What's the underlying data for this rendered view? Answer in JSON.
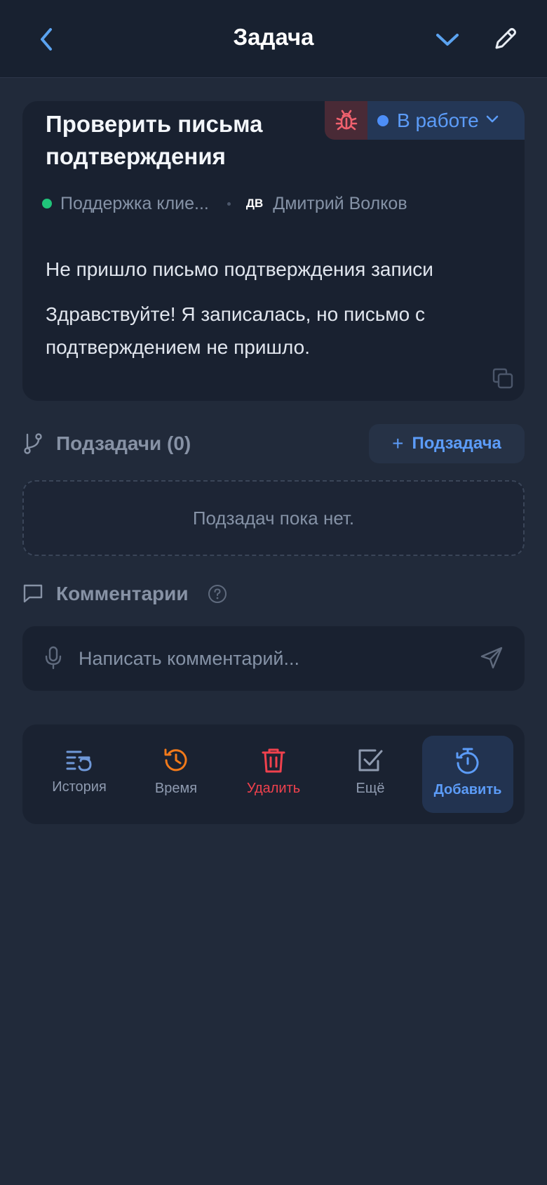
{
  "header": {
    "title": "Задача",
    "back_icon": "chevron-left-icon",
    "collapse_icon": "chevron-down-icon",
    "edit_icon": "pencil-icon"
  },
  "task": {
    "title": "Проверить письма подтверждения",
    "type_icon": "bug-icon",
    "status": "В работе",
    "status_color": "#4d8ef7",
    "project": "Поддержка клие...",
    "project_color": "#20c47a",
    "assignee_initials": "ДВ",
    "assignee": "Дмитрий Волков",
    "description_title": "Не пришло письмо подтверждения записи",
    "description_body": "Здравствуйте! Я записалась, но письмо с подтверждением не пришло."
  },
  "subtasks": {
    "label": "Подзадачи (0)",
    "add_plus": "+",
    "add_label": "Подзадача",
    "empty_text": "Подзадач пока нет."
  },
  "comments": {
    "label": "Комментарии",
    "placeholder": "Написать комментарий..."
  },
  "actions": [
    {
      "label": "История",
      "icon": "history-list-icon",
      "color": "#6f98d8"
    },
    {
      "label": "Время",
      "icon": "clock-history-icon",
      "color": "#f27a1a"
    },
    {
      "label": "Удалить",
      "icon": "trash-icon",
      "color": "#f0414d"
    },
    {
      "label": "Ещё",
      "icon": "checkbox-icon",
      "color": "#8f9bb0"
    },
    {
      "label": "Добавить",
      "icon": "timer-add-icon",
      "color": "#5c9cf8"
    }
  ],
  "colors": {
    "background": "#212a3a",
    "card": "#192130",
    "accent": "#5c9cf8"
  }
}
